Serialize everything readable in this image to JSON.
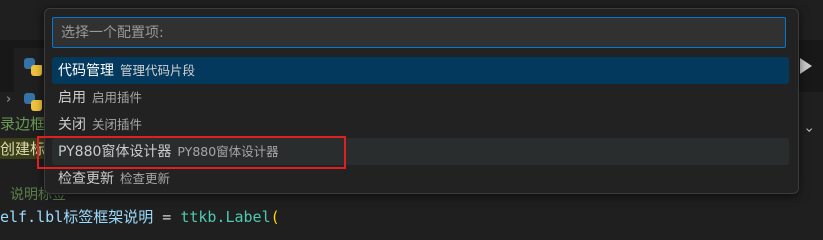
{
  "quick_pick": {
    "placeholder": "选择一个配置项:",
    "items": [
      {
        "label": "代码管理",
        "description": "管理代码片段",
        "state": "active"
      },
      {
        "label": "启用",
        "description": "启用插件",
        "state": "normal"
      },
      {
        "label": "关闭",
        "description": "关闭插件",
        "state": "normal"
      },
      {
        "label": "PY880窗体设计器",
        "description": "PY880窗体设计器",
        "state": "hover"
      },
      {
        "label": "检查更新",
        "description": "检查更新",
        "state": "normal"
      }
    ]
  },
  "editor_fragments": {
    "line1": "录边框",
    "line2": "创建标",
    "comment": "说明标签",
    "code_left": "elf.lbl标签框架说明",
    "code_op": " = ",
    "code_cls": "ttkb.Label",
    "code_punc": "("
  },
  "colors": {
    "accent_border": "#0078d4",
    "active_item": "#04395e",
    "highlight_annotation": "#e02020"
  },
  "icons": [
    "python-file-icon",
    "python-file-icon",
    "run-icon",
    "chevron-icon"
  ]
}
